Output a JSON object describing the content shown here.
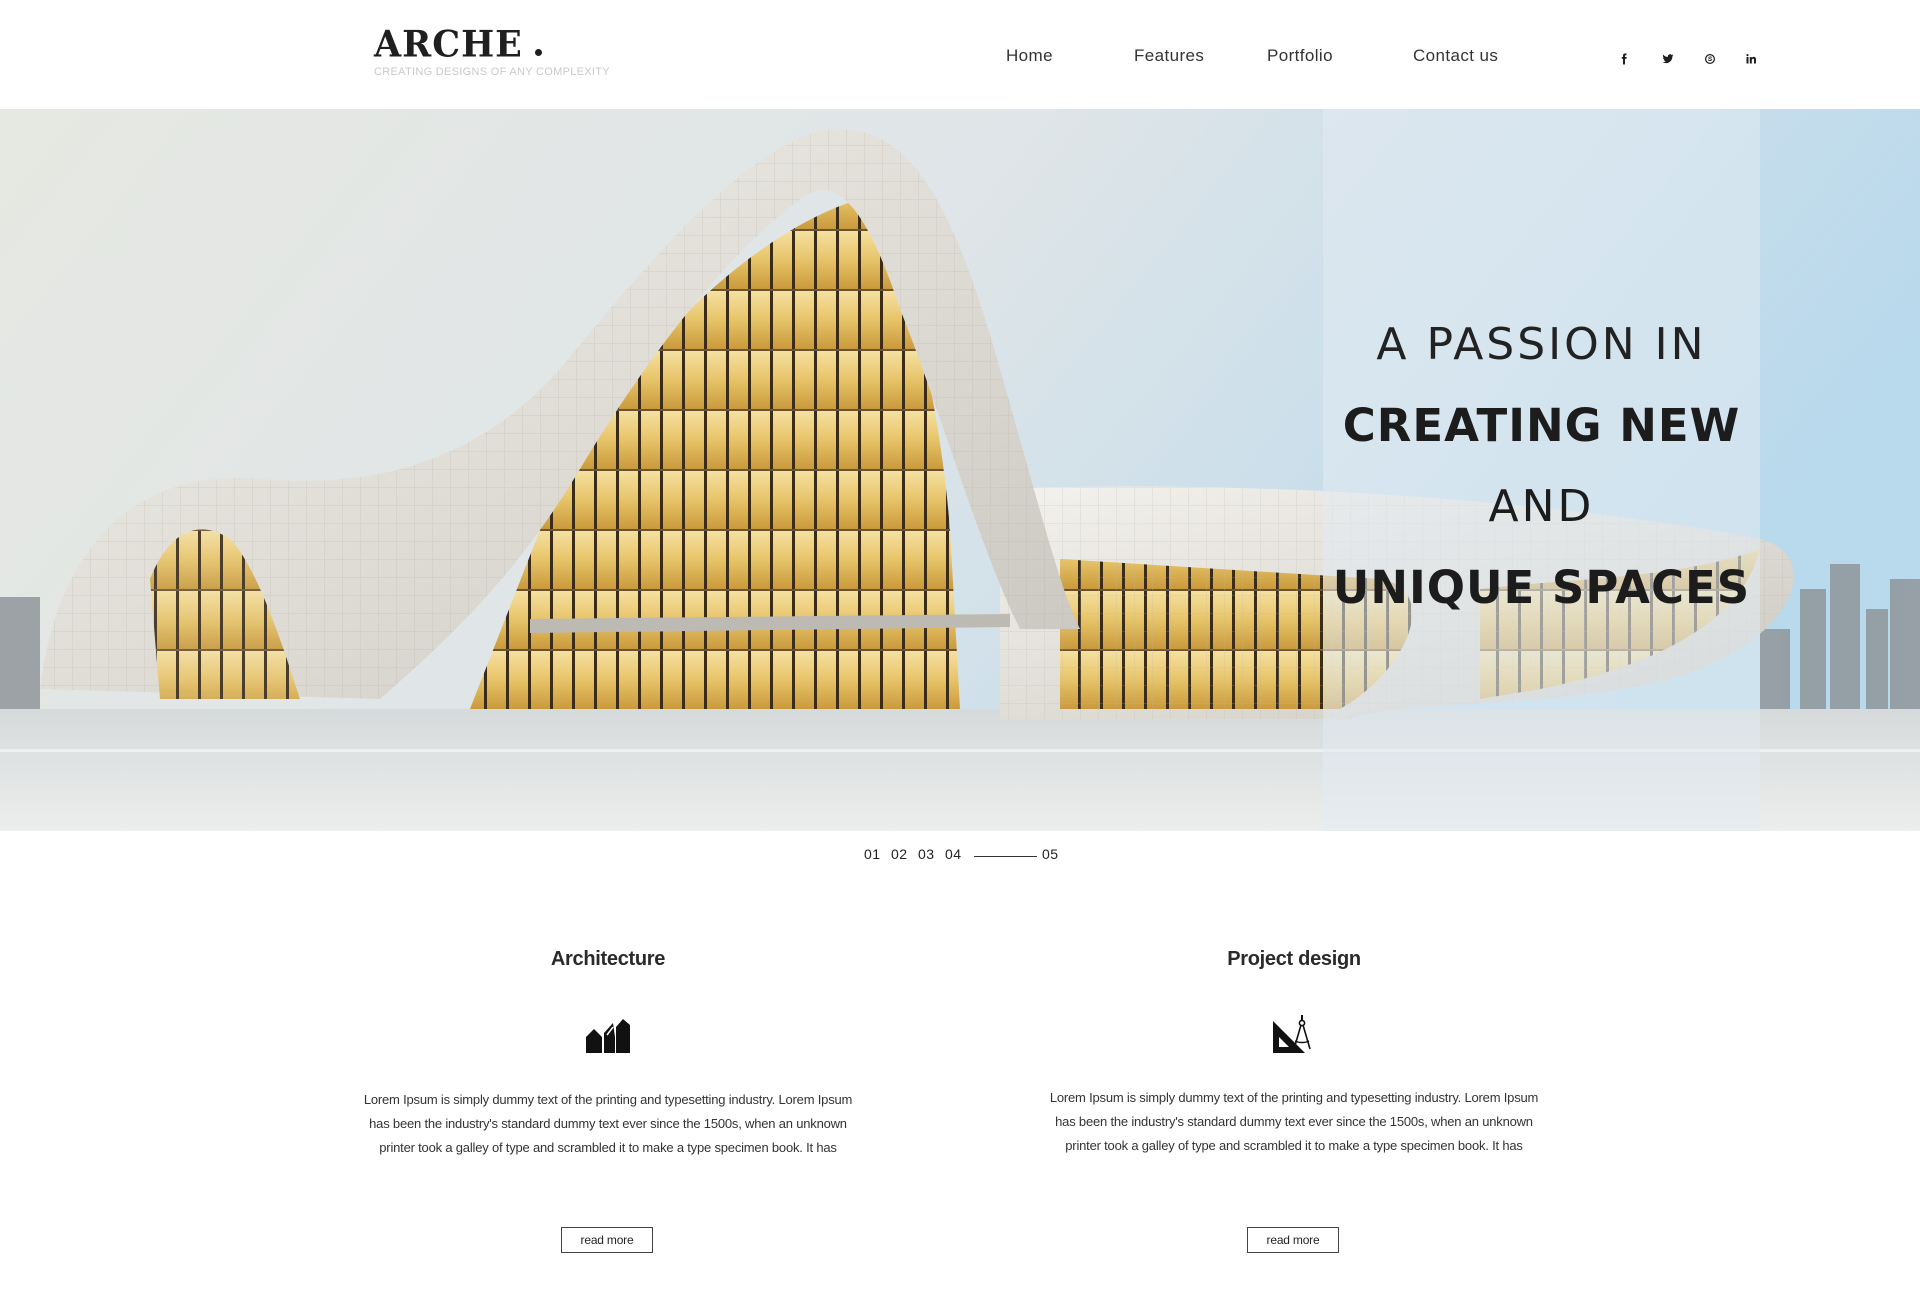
{
  "brand": {
    "name": "ARCHE",
    "tagline": "CREATING DESIGNS OF ANY COMPLEXITY"
  },
  "nav": {
    "items": [
      "Home",
      "Features",
      "Portfolio",
      "Contact us"
    ]
  },
  "social": [
    "facebook-icon",
    "twitter-icon",
    "skype-icon",
    "linkedin-icon"
  ],
  "hero": {
    "lines": [
      "A PASSION IN",
      "CREATING NEW",
      "AND",
      "UNIQUE SPACES"
    ]
  },
  "slider": {
    "pages": [
      "01",
      "02",
      "03",
      "04",
      "05"
    ],
    "active": "05"
  },
  "features": [
    {
      "title": "Architecture",
      "icon": "buildings-icon",
      "text": "Lorem Ipsum is simply dummy text of the printing and typesetting industry. Lorem Ipsum has been the industry's standard dummy text ever since the 1500s, when an unknown printer took a galley of type and scrambled it to make a type specimen book. It has",
      "button": "read more"
    },
    {
      "title": "Project design",
      "icon": "drafting-tools-icon",
      "text": "Lorem Ipsum is simply dummy text of the printing and typesetting industry. Lorem Ipsum has been the industry's standard dummy text ever since the 1500s, when an unknown printer took a galley of type and scrambled it to make a type specimen book. It has",
      "button": "read more"
    }
  ],
  "colors": {
    "accent": "#1f1f1f",
    "panel": "#e1ebf2",
    "building": "#e9e6e0",
    "glass": "#e8c56a"
  }
}
